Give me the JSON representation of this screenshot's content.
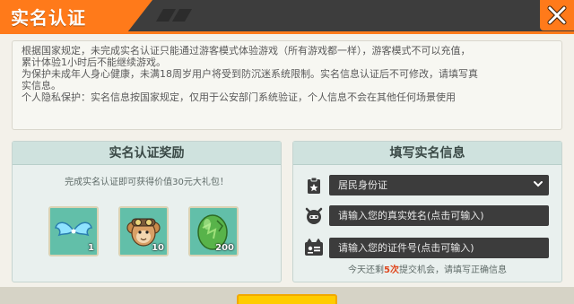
{
  "dialog": {
    "title": "实名认证",
    "close_icon": "close-icon"
  },
  "notice": {
    "line1": "根据国家规定，未完成实名认证只能通过游客模式体验游戏（所有游戏都一样），游客模式不可以充值，",
    "line2": "累计体验1小时后不能继续游戏。",
    "line3": "为保护未成年人身心健康，未满18周岁用户将受到防沉迷系统限制。实名信息认证后不可修改，请填写真",
    "line4": "实信息。",
    "line5": "个人隐私保护：实名信息按国家规定，仅用于公安部门系统验证，个人信息不会在其他任何场景使用"
  },
  "reward_panel": {
    "header": "实名认证奖励",
    "description": "完成实名认证即可获得价值30元大礼包！",
    "items": [
      {
        "icon": "blue-wings-icon",
        "count": "1"
      },
      {
        "icon": "pilot-monkey-icon",
        "count": "10"
      },
      {
        "icon": "green-egg-icon",
        "count": "200"
      }
    ]
  },
  "form_panel": {
    "header": "填写实名信息",
    "id_type_icon": "clipboard-icon",
    "id_type_value": "居民身份证",
    "name_icon": "user-icon",
    "name_placeholder": "请输入您的真实姓名(点击可输入)",
    "id_icon": "id-card-icon",
    "id_placeholder": "请输入您的证件号(点击可输入)",
    "hint_prefix": "今天还剩",
    "hint_count": "5次",
    "hint_suffix": "提交机会，请填写正确信息"
  },
  "colors": {
    "accent": "#ff7a1a",
    "title_bar": "#3d3d3d",
    "panel": "#e9f0ee",
    "panel_header": "#cfe2de",
    "field": "#3c3c3c",
    "warning": "#e0481f",
    "submit": "#ffcc00"
  }
}
